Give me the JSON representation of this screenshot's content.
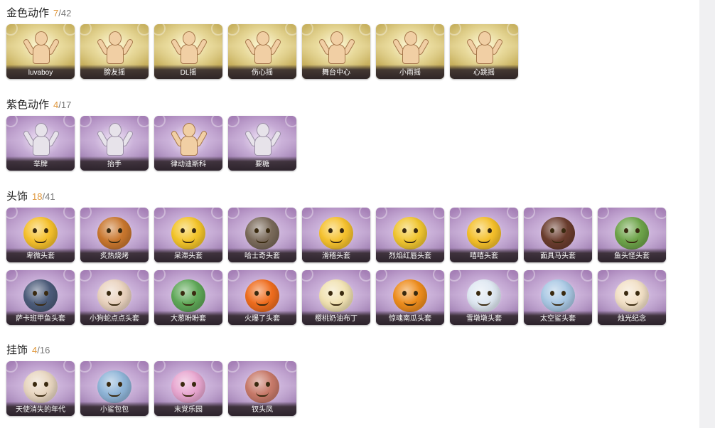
{
  "sections": [
    {
      "title": "金色动作",
      "owned": "7",
      "total": "42",
      "rarity": "gold",
      "items": [
        {
          "label": "luvaboy",
          "art": "pose-figure"
        },
        {
          "label": "膀友摇",
          "art": "pose-figure"
        },
        {
          "label": "DL摇",
          "art": "pose-figure"
        },
        {
          "label": "伤心摇",
          "art": "pose-figure"
        },
        {
          "label": "舞台中心",
          "art": "pose-figure"
        },
        {
          "label": "小雨摇",
          "art": "pose-figure"
        },
        {
          "label": "心跳摇",
          "art": "pose-figure"
        }
      ]
    },
    {
      "title": "紫色动作",
      "owned": "4",
      "total": "17",
      "rarity": "purple",
      "items": [
        {
          "label": "举牌",
          "art": "pose-figure-ghost"
        },
        {
          "label": "抬手",
          "art": "pose-figure-ghost"
        },
        {
          "label": "律动迪斯科",
          "art": "pose-figure"
        },
        {
          "label": "要糖",
          "art": "pose-figure-ghost"
        }
      ]
    },
    {
      "title": "头饰",
      "owned": "18",
      "total": "41",
      "rarity": "purple",
      "items": [
        {
          "label": "卑微头套",
          "art": "emoji-mask",
          "color": "#f6c12c"
        },
        {
          "label": "炙热烧烤",
          "art": "emoji-mask",
          "color": "#c9772e"
        },
        {
          "label": "呆滞头套",
          "art": "emoji-mask",
          "color": "#f4c52a"
        },
        {
          "label": "哈士奇头套",
          "art": "emoji-mask",
          "color": "#7a6a5a"
        },
        {
          "label": "滑稽头套",
          "art": "emoji-mask",
          "color": "#f6c22e"
        },
        {
          "label": "烈焰红唇头套",
          "art": "emoji-mask",
          "color": "#f1c630"
        },
        {
          "label": "嘻嘻头套",
          "art": "emoji-mask",
          "color": "#f5c02b"
        },
        {
          "label": "面具马头套",
          "art": "emoji-mask",
          "color": "#6b3d2e"
        },
        {
          "label": "鱼头怪头套",
          "art": "emoji-mask",
          "color": "#6ea44a"
        },
        {
          "label": "萨卡班甲鱼头套",
          "art": "emoji-mask",
          "color": "#4c5c7a"
        },
        {
          "label": "小狗蛇点点头套",
          "art": "emoji-mask",
          "color": "#e9d2be"
        },
        {
          "label": "大葱盼盼套",
          "art": "emoji-mask",
          "color": "#5fa858"
        },
        {
          "label": "火爆了头套",
          "art": "emoji-mask",
          "color": "#ef6d1e"
        },
        {
          "label": "樱桃奶油布丁",
          "art": "emoji-mask",
          "color": "#f1e2b2"
        },
        {
          "label": "惊魂南瓜头套",
          "art": "emoji-mask",
          "color": "#ee8d1d"
        },
        {
          "label": "雪墩墩头套",
          "art": "emoji-mask",
          "color": "#dfe8f2"
        },
        {
          "label": "太空鲨头套",
          "art": "emoji-mask",
          "color": "#a9c8e4"
        },
        {
          "label": "烛光纪念",
          "art": "emoji-mask",
          "color": "#f2e0c6"
        }
      ]
    },
    {
      "title": "挂饰",
      "owned": "4",
      "total": "16",
      "rarity": "purple",
      "items": [
        {
          "label": "天使消失的年代",
          "art": "emoji-mask",
          "color": "#e8d6c0"
        },
        {
          "label": "小鲨包包",
          "art": "emoji-mask",
          "color": "#8fb5d8"
        },
        {
          "label": "末覚乐园",
          "art": "emoji-mask",
          "color": "#e8a6d0"
        },
        {
          "label": "钗头凤",
          "art": "emoji-mask",
          "color": "#c87a6a"
        }
      ]
    }
  ]
}
